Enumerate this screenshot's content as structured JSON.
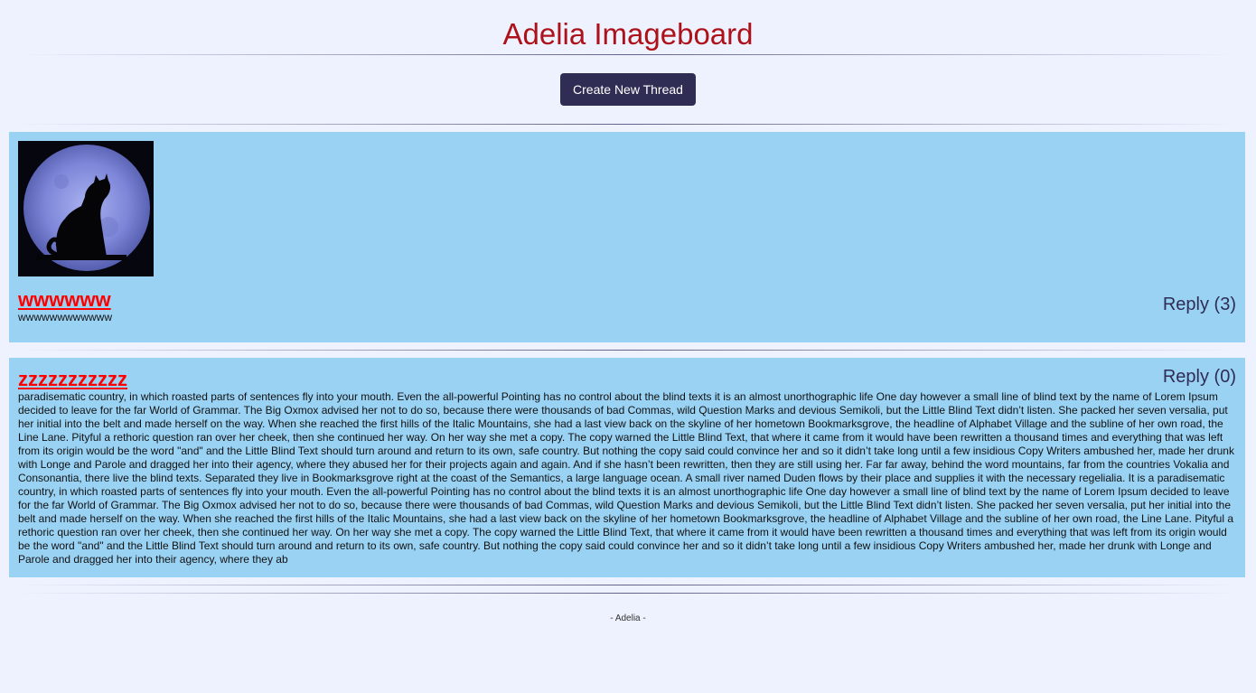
{
  "site": {
    "title": "Adelia Imageboard",
    "create_button_label": "Create New Thread",
    "footer": "- Adelia -"
  },
  "threads": [
    {
      "title": "wwwwww",
      "body": "wwwwwwwwwwww",
      "reply_label": "Reply (3)",
      "has_image": true,
      "image_icon": "moon-cat-thumbnail"
    },
    {
      "title": "zzzzzzzzzzz",
      "body": "paradisematic country, in which roasted parts of sentences fly into your mouth. Even the all-powerful Pointing has no control about the blind texts it is an almost unorthographic life One day however a small line of blind text by the name of Lorem Ipsum decided to leave for the far World of Grammar. The Big Oxmox advised her not to do so, because there were thousands of bad Commas, wild Question Marks and devious Semikoli, but the Little Blind Text didn’t listen. She packed her seven versalia, put her initial into the belt and made herself on the way. When she reached the first hills of the Italic Mountains, she had a last view back on the skyline of her hometown Bookmarksgrove, the headline of Alphabet Village and the subline of her own road, the Line Lane. Pityful a rethoric question ran over her cheek, then she continued her way. On her way she met a copy. The copy warned the Little Blind Text, that where it came from it would have been rewritten a thousand times and everything that was left from its origin would be the word \"and\" and the Little Blind Text should turn around and return to its own, safe country. But nothing the copy said could convince her and so it didn’t take long until a few insidious Copy Writers ambushed her, made her drunk with Longe and Parole and dragged her into their agency, where they abused her for their projects again and again. And if she hasn’t been rewritten, then they are still using her. Far far away, behind the word mountains, far from the countries Vokalia and Consonantia, there live the blind texts. Separated they live in Bookmarksgrove right at the coast of the Semantics, a large language ocean. A small river named Duden flows by their place and supplies it with the necessary regelialia. It is a paradisematic country, in which roasted parts of sentences fly into your mouth. Even the all-powerful Pointing has no control about the blind texts it is an almost unorthographic life One day however a small line of blind text by the name of Lorem Ipsum decided to leave for the far World of Grammar. The Big Oxmox advised her not to do so, because there were thousands of bad Commas, wild Question Marks and devious Semikoli, but the Little Blind Text didn’t listen. She packed her seven versalia, put her initial into the belt and made herself on the way. When she reached the first hills of the Italic Mountains, she had a last view back on the skyline of her hometown Bookmarksgrove, the headline of Alphabet Village and the subline of her own road, the Line Lane. Pityful a rethoric question ran over her cheek, then she continued her way. On her way she met a copy. The copy warned the Little Blind Text, that where it came from it would have been rewritten a thousand times and everything that was left from its origin would be the word \"and\" and the Little Blind Text should turn around and return to its own, safe country. But nothing the copy said could convince her and so it didn’t take long until a few insidious Copy Writers ambushed her, made her drunk with Longe and Parole and dragged her into their agency, where they ab",
      "reply_label": "Reply (0)",
      "has_image": false
    }
  ],
  "colors": {
    "background": "#eef2fe",
    "title": "#ad1119",
    "button": "#2f2d54",
    "thread_bg": "#9ad2f4",
    "thread_title": "#ff0000"
  }
}
